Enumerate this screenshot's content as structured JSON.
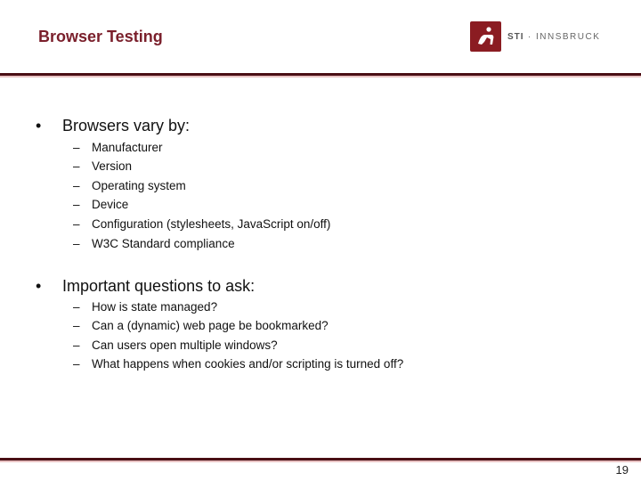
{
  "slide": {
    "title": "Browser Testing",
    "page_number": "19"
  },
  "logo": {
    "brand_bold": "STI",
    "separator": "·",
    "brand_rest": "INNSBRUCK",
    "brand_color": "#8b1c22"
  },
  "sections": [
    {
      "bullet": "•",
      "heading": "Browsers vary by:",
      "items": [
        "Manufacturer",
        "Version",
        "Operating system",
        "Device",
        "Configuration (stylesheets, JavaScript on/off)",
        "W3C Standard compliance"
      ]
    },
    {
      "bullet": "•",
      "heading": "Important questions to ask:",
      "items": [
        "How is state managed?",
        "Can a (dynamic) web page be bookmarked?",
        "Can users open multiple windows?",
        "What happens when cookies and/or scripting is turned off?"
      ]
    }
  ],
  "dash": "–"
}
